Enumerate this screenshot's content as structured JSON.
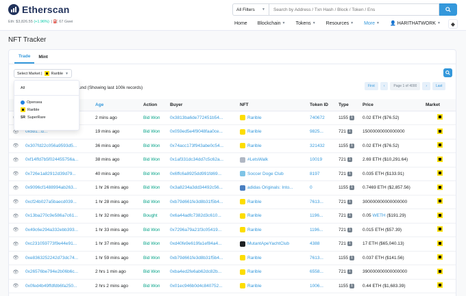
{
  "header": {
    "logo": "Etherscan",
    "eth_price": "Eth: $3,826.55",
    "eth_change": "(+1.96%)",
    "gas": "67 Gwei",
    "filter": "All Filters",
    "search_placeholder": "Search by Address / Txn Hash / Block / Token / Ens",
    "nav": [
      "Home",
      "Blockchain",
      "Tokens",
      "Resources",
      "More"
    ],
    "user": "HARITHATWORK"
  },
  "page_title": "NFT Tracker",
  "tabs": [
    "Trade",
    "Mint"
  ],
  "market_label": "Select Market",
  "market_selected": "Rarible",
  "market_options": {
    "all": "All",
    "opensea": "Opensea",
    "rarible": "Rarible",
    "superrare": "SuperRare"
  },
  "found_text": "und (Showing last 100k records)",
  "pager": {
    "first": "First",
    "page": "Page 1 of 4000",
    "last": "Last"
  },
  "columns": [
    "",
    "Txn Hash",
    "Age",
    "Action",
    "Buyer",
    "NFT",
    "Token ID",
    "Type",
    "Price",
    "Market"
  ],
  "rows": [
    {
      "hash": "0xd3e...8d...",
      "age": "2 mins ago",
      "action": "Bid Won",
      "buyer": "0x3813ba6de772451b54...",
      "nft": "Rarible",
      "token": "740672",
      "type": "1155",
      "price": "0.02 ETH ($76.52)",
      "thumb": "#fddd00"
    },
    {
      "hash": "0x5b1...d...",
      "age": "19 mins ago",
      "action": "Bid Won",
      "buyer": "0x059ed5e4f9048faa0ce...",
      "nft": "Rarible",
      "token": "9825...",
      "type": "721",
      "price": "15000000000000000",
      "thumb": "#fddd00"
    },
    {
      "hash": "0x307fd22c056a9593d5...",
      "age": "36 mins ago",
      "action": "Bid Won",
      "buyer": "0x74acc173f943abe0c54...",
      "nft": "Rarible",
      "token": "321432",
      "type": "1155",
      "price": "0.02 ETH ($76.52)",
      "thumb": "#fddd00"
    },
    {
      "hash": "0xf14ffd7b5f024455756a...",
      "age": "38 mins ago",
      "action": "Bid Won",
      "buyer": "0x1af331dc34dd7c5c62a...",
      "nft": "#LetsWalk",
      "token": "10019",
      "type": "721",
      "price": "2.69 ETH ($10,291.64)",
      "thumb": "#b0b7c3"
    },
    {
      "hash": "0x726e1a82912d39d79...",
      "age": "40 mins ago",
      "action": "Bid Won",
      "buyer": "0x6ffc6a8925dd991fd69...",
      "nft": "Soccer Doge Club",
      "token": "8197",
      "type": "721",
      "price": "0.035 ETH ($133.91)",
      "thumb": "#7fc4e6"
    },
    {
      "hash": "0x9096cf1488994ab263...",
      "age": "1 hr 26 mins ago",
      "action": "Bid Won",
      "buyer": "0x3a8234a3dd34492c56...",
      "nft": "adidas Originals: Into...",
      "token": "0",
      "type": "1155",
      "price": "0.7469 ETH ($2,857.56)",
      "thumb": "#4a7fc1"
    },
    {
      "hash": "0xcf24b027a5baecd039...",
      "age": "1 hr 28 mins ago",
      "action": "Bid Won",
      "buyer": "0xb79d661fe3d8b31f5b4...",
      "nft": "Rarible",
      "token": "7613...",
      "type": "721",
      "price": "300000000000000000",
      "thumb": "#fddd00"
    },
    {
      "hash": "0x13ba270c9e586a7c61...",
      "age": "1 hr 32 mins ago",
      "action": "Bought",
      "buyer": "0x6a44adfc7382d3c610...",
      "nft": "Rarible",
      "token": "1196...",
      "type": "721",
      "price_pre": "0.05",
      "price_unit": "WETH",
      "price_post": "($191.29)",
      "thumb": "#fddd00"
    },
    {
      "hash": "0x49c6e294a332ebb393...",
      "age": "1 hr 33 mins ago",
      "action": "Bid Won",
      "buyer": "0x7296a79a21f3c05419...",
      "nft": "Rarible",
      "token": "1196...",
      "type": "721",
      "price": "0.015 ETH ($57.39)",
      "thumb": "#fddd00"
    },
    {
      "hash": "0xc231059773f9e44e91...",
      "age": "1 hr 37 mins ago",
      "action": "Bid Won",
      "buyer": "0xd40fe9e619fa1ef84a4...",
      "nft": "MutantApeYachtClub",
      "token": "4388",
      "type": "721",
      "price": "17 ETH ($65,040.13)",
      "thumb": "#1e2022"
    },
    {
      "hash": "0xe8363252242d73dc74...",
      "age": "1 hr 59 mins ago",
      "action": "Bid Won",
      "buyer": "0xb79d661fe3d8b31f5b4...",
      "nft": "Rarible",
      "token": "7613...",
      "type": "1155",
      "price": "0.037 ETH ($141.56)",
      "thumb": "#fddd00"
    },
    {
      "hash": "0x26576be794e2b06b6c...",
      "age": "2 hrs 1 min ago",
      "action": "Bid Won",
      "buyer": "0xba4ed2fe6ab62dc82b...",
      "nft": "Rarible",
      "token": "6558...",
      "type": "721",
      "price": "390000000000000000",
      "thumb": "#fddd00"
    },
    {
      "hash": "0x0fed4b49ffdfdb6fa250...",
      "age": "2 hrs 2 mins ago",
      "action": "Bid Won",
      "buyer": "0x01ec946b0d4c840752...",
      "nft": "Rarible",
      "token": "1006...",
      "type": "1155",
      "price": "0.44 ETH ($1,683.39)",
      "thumb": "#fddd00"
    }
  ]
}
